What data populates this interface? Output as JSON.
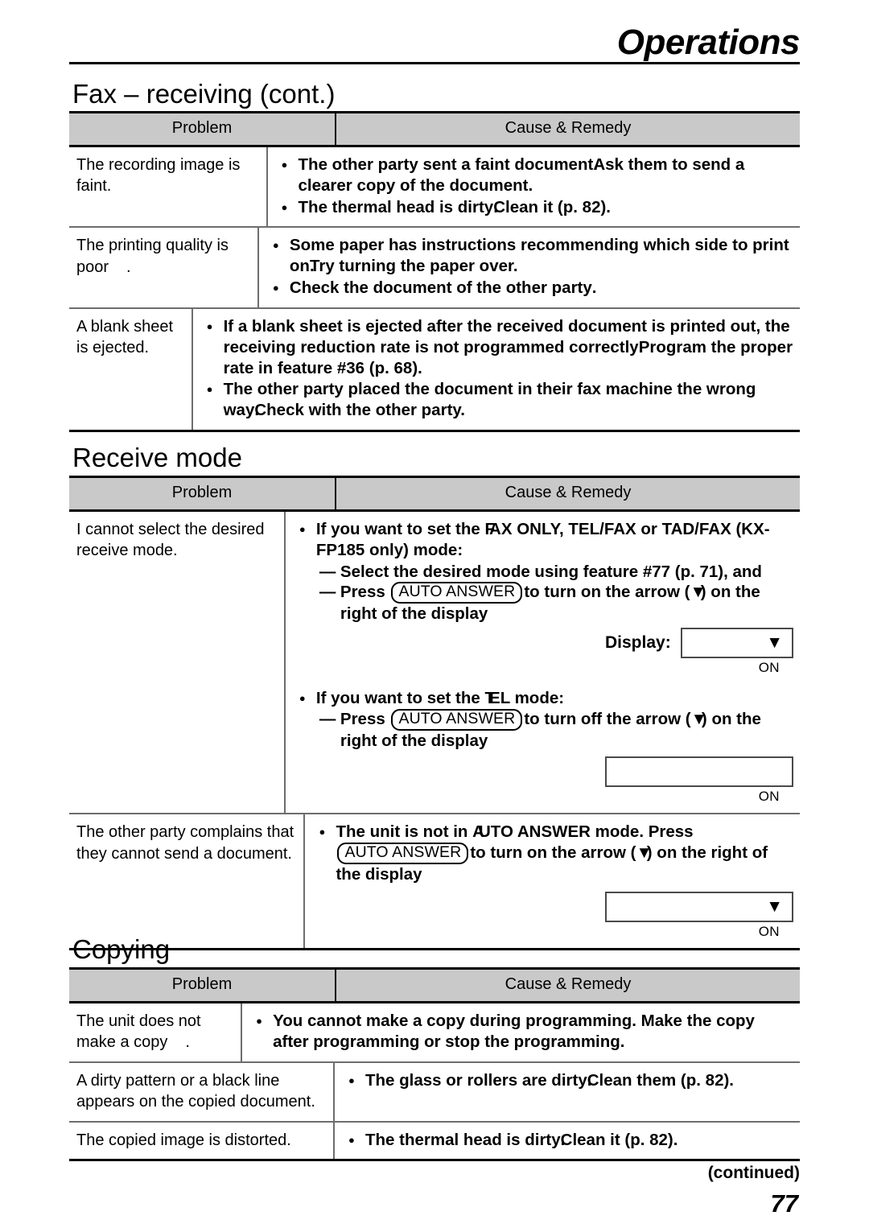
{
  "running_head": {
    "title": "Operations"
  },
  "sections": [
    {
      "heading": "Fax – receiving (cont.)",
      "columns": {
        "problem": "Problem",
        "cause": "Cause & Remedy"
      },
      "rows": [
        {
          "problem": "The recording image is faint.",
          "problem_stray": "",
          "bullets": [
            {
              "a": "The other party sent a faint document",
              "jam": ".",
              "b": "Ask them to send a clearer copy of the document."
            },
            {
              "a": "The thermal head is dirty",
              "jam": ".",
              "b": "Clean it (p. 82)."
            }
          ]
        },
        {
          "problem": "The printing quality is poor",
          "problem_stray": ".",
          "bullets": [
            {
              "a": "Some paper has instructions recommending which side to print on",
              "jam": ".",
              "b": "Try turning the paper over."
            },
            {
              "a": "Check the document of the other party",
              "jam": "",
              "b": "."
            }
          ]
        },
        {
          "problem": "A blank sheet is ejected.",
          "problem_stray": "",
          "bullets": [
            {
              "a": "If a blank sheet is ejected after the received document is printed out, the receiving reduction rate is not programmed correctly",
              "jam": ".",
              "b": "Program the proper rate in feature #36 (p. 68)."
            },
            {
              "a": "The other party placed the document in their fax machine the wrong way",
              "jam": ".",
              "b": "Check with the other party."
            }
          ]
        }
      ]
    },
    {
      "heading": "Receive mode",
      "columns": {
        "problem": "Problem",
        "cause": "Cause & Remedy"
      },
      "rows": [
        {
          "problem": "I cannot select the desired receive mode.",
          "problem_stray": "",
          "block_a": {
            "lead_a": "If you want to set the ",
            "lead_jam": "F",
            "lead_b": "AX ONLY, TEL/FAX or TAD/FAX (KX-FP185 only) mode:",
            "dash1": "Select the desired mode using feature #77 (p. 71), and",
            "dash2_pre": "Press",
            "keycap": "AUTO ANSWER",
            "dash2_post_a": "to turn on the arrow (",
            "dash2_arrow": "▼",
            "dash2_post_b": ") on the right of the display",
            "display_label": "Display:",
            "lcd_arrow": "▼",
            "lcd_on": "ON"
          },
          "block_b": {
            "lead_a": "If you want to set the ",
            "lead_jam": "T",
            "lead_b": "EL mode:",
            "dash2_pre": "Press",
            "keycap": "AUTO ANSWER",
            "dash2_post_a": "to turn off the arrow (",
            "dash2_arrow": "▼",
            "dash2_post_b": ") on the right of the display",
            "lcd_arrow": "",
            "lcd_on": "ON"
          }
        },
        {
          "problem": "The other party complains that they cannot send a document.",
          "problem_stray": "",
          "block_c": {
            "lead_a": "The unit is not in ",
            "lead_jam": "A",
            "lead_b": "UTO ANSWER mode. Press",
            "keycap": "AUTO ANSWER",
            "post_a": "to turn on the arrow (",
            "post_arrow": "▼",
            "post_b": ") on the right of the display",
            "lcd_arrow": "▼",
            "lcd_on": "ON"
          }
        }
      ]
    },
    {
      "heading": "Copying",
      "columns": {
        "problem": "Problem",
        "cause": "Cause & Remedy"
      },
      "rows": [
        {
          "problem": "The unit does not make a copy",
          "problem_stray": ".",
          "bullets": [
            {
              "a": "You cannot make a copy during programming. Make the copy after programming or stop the programming.",
              "jam": "",
              "b": ""
            }
          ]
        },
        {
          "problem": "A dirty pattern or a black line appears on the copied document.",
          "problem_stray": "",
          "bullets": [
            {
              "a": "The glass or rollers are dirty",
              "jam": ".",
              "b": "Clean them (p. 82)."
            }
          ]
        },
        {
          "problem": "The copied image is distorted.",
          "problem_stray": "",
          "bullets": [
            {
              "a": "The thermal head is dirty",
              "jam": ".",
              "b": "Clean it (p. 82)."
            }
          ]
        }
      ]
    }
  ],
  "footer": {
    "continued": "(continued)",
    "page_number": "77"
  }
}
